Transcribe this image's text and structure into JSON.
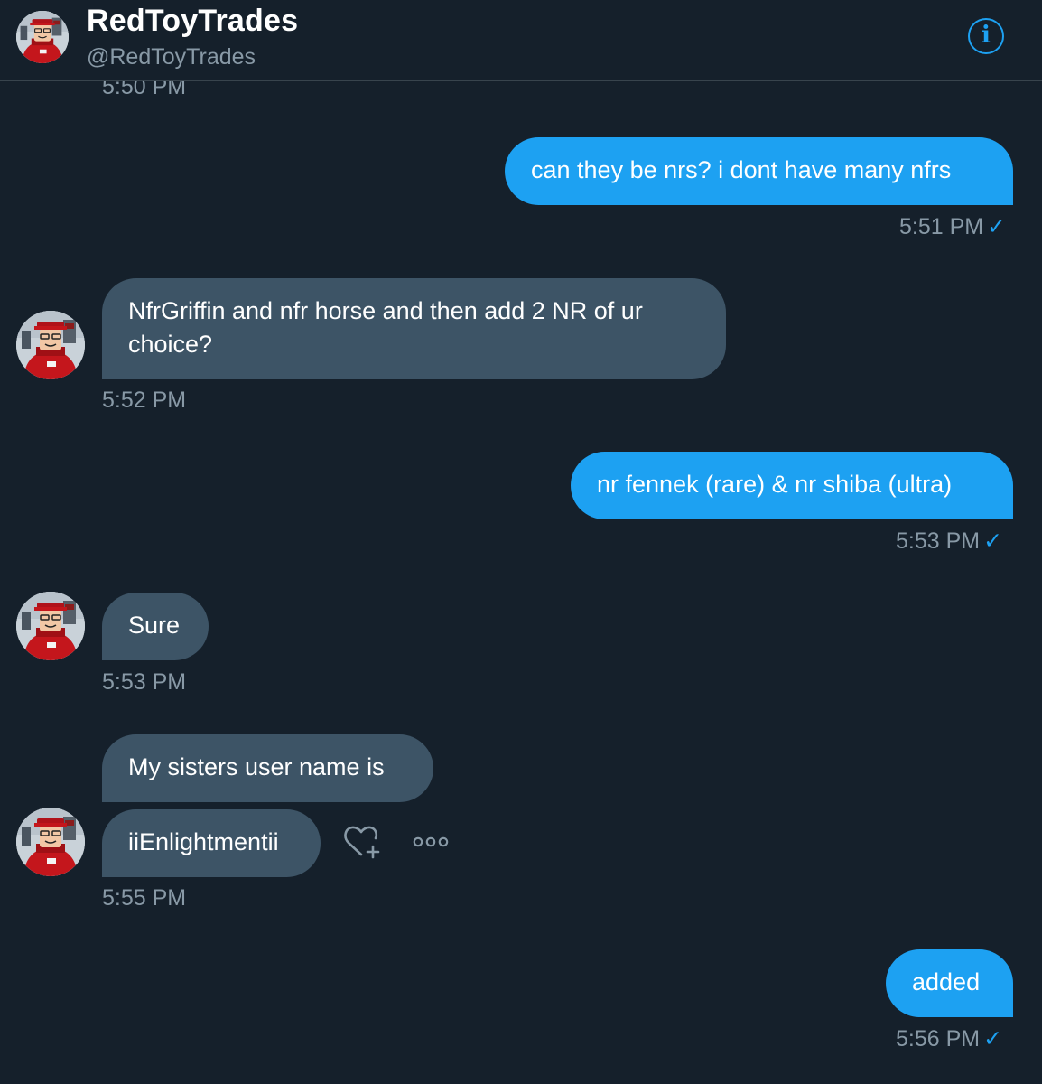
{
  "header": {
    "name": "RedToyTrades",
    "handle": "@RedToyTrades",
    "info_icon": "info-icon",
    "info_glyph": "i"
  },
  "messages": [
    {
      "id": "prev",
      "timestamp": "5:50 PM"
    },
    {
      "id": "m1",
      "direction": "outgoing",
      "text": "can they be nrs? i dont have many nfrs",
      "timestamp": "5:51 PM",
      "read_icon": "check-icon"
    },
    {
      "id": "m2",
      "direction": "incoming",
      "lines": [
        "NfrGriffin and nfr horse and then add 2 NR of ur",
        "choice?"
      ],
      "timestamp": "5:52 PM"
    },
    {
      "id": "m3",
      "direction": "outgoing",
      "text": "nr fennek (rare) & nr shiba (ultra)",
      "timestamp": "5:53 PM",
      "read_icon": "check-icon"
    },
    {
      "id": "m4",
      "direction": "incoming",
      "text": "Sure",
      "timestamp": "5:53 PM"
    },
    {
      "id": "m5",
      "direction": "incoming",
      "text": "My sisters user name is"
    },
    {
      "id": "m6",
      "direction": "incoming",
      "text": "iiEnlightmentii",
      "timestamp": "5:55 PM",
      "actions": [
        "heart-plus-icon",
        "more-icon"
      ]
    },
    {
      "id": "m7",
      "direction": "outgoing",
      "text": "added",
      "timestamp": "5:56 PM",
      "read_icon": "check-icon"
    }
  ],
  "check_glyph": "✓",
  "colors": {
    "background": "#15202b",
    "outgoing_bubble": "#1da1f2",
    "incoming_bubble": "#3d5466",
    "muted_text": "#8899a6",
    "accent": "#1da1f2"
  }
}
